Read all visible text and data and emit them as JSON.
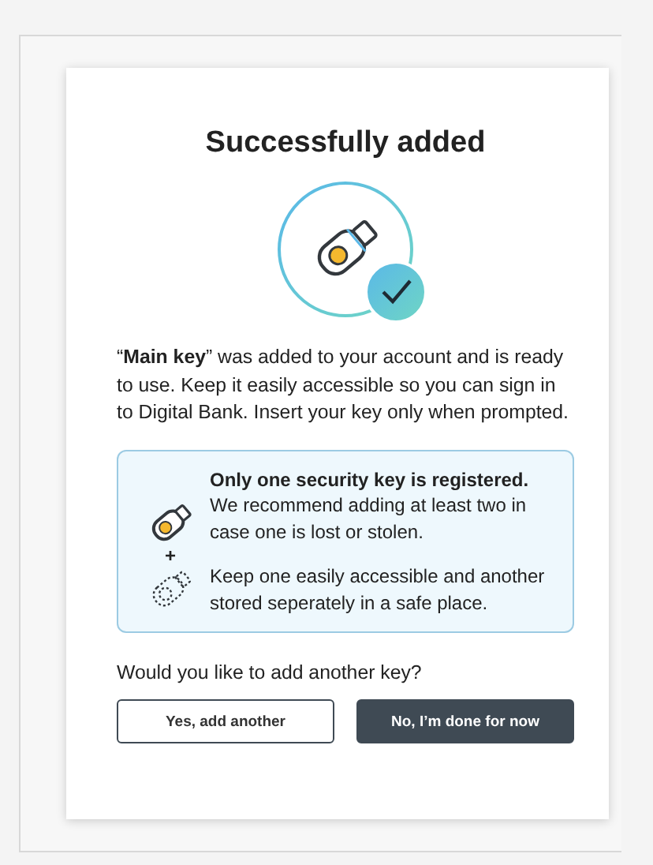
{
  "dialog": {
    "title": "Successfully added",
    "message": "“**Main key**” was added to your account and is ready to use. Keep it easily accessible so you can sign in to Digital Bank. Insert your key only when prompted.",
    "notice": {
      "heading": "Only one security key is registered.",
      "body": "We recommend adding at least two in case one is lost or stolen.",
      "plus": "+",
      "tip": "Keep one easily accessible and another stored seperately in a safe place."
    },
    "question": "Would you like to add another key?",
    "buttons": [
      {
        "label": "Yes, add another",
        "kind": "secondary"
      },
      {
        "label": "No, I’m done for now",
        "kind": "primary"
      }
    ]
  }
}
